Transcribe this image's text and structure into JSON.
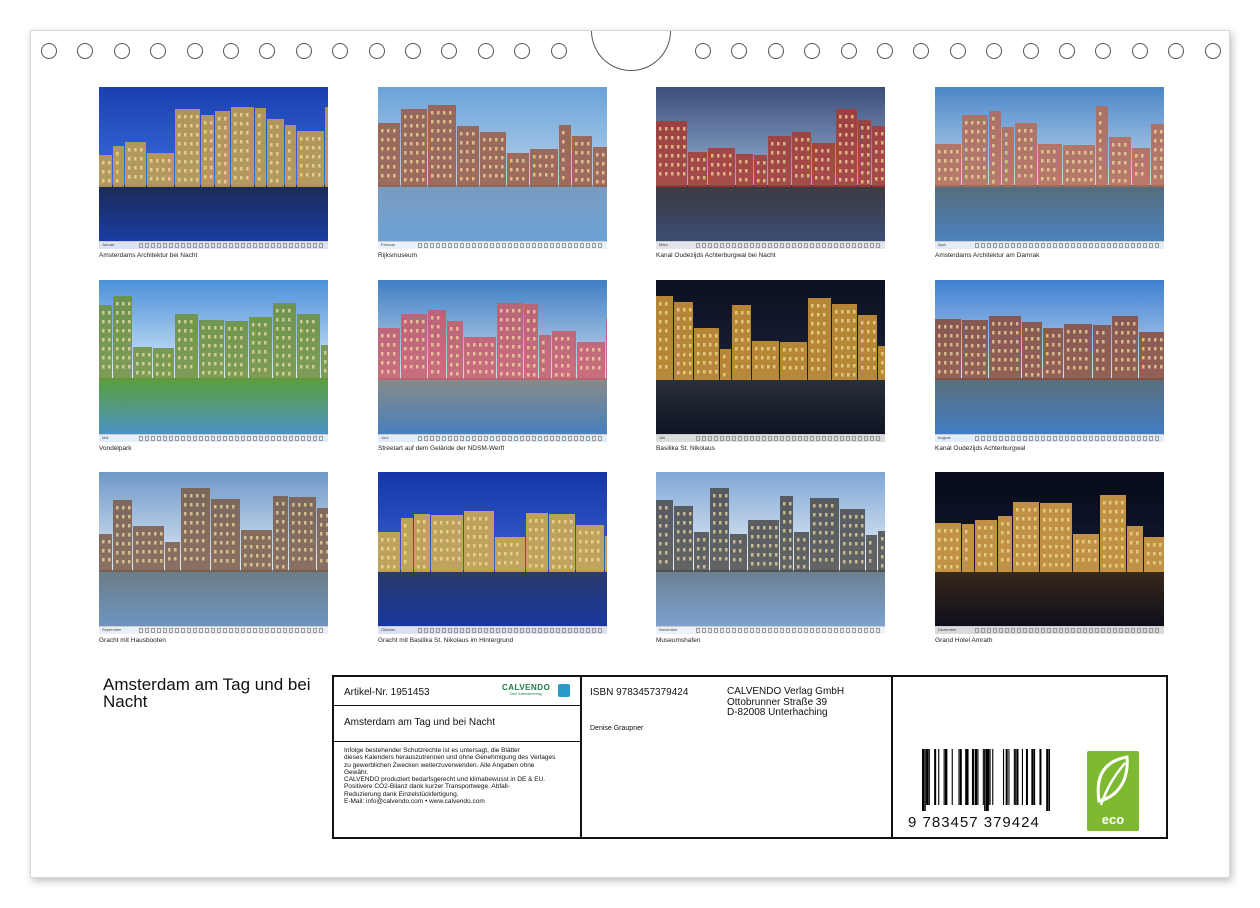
{
  "photos": [
    {
      "caption": "Amsterdams Architektur bei Nacht",
      "month": "Januar"
    },
    {
      "caption": "Rijksmuseum",
      "month": "Februar"
    },
    {
      "caption": "Kanal Oudezijds Achterburgwal bei Nacht",
      "month": "März"
    },
    {
      "caption": "Amsterdams Architektur am Damrak",
      "month": "April"
    },
    {
      "caption": "Vondelpark",
      "month": "Mai"
    },
    {
      "caption": "Streetart auf dem Gelände der NDSM-Werft",
      "month": "Juni"
    },
    {
      "caption": "Basilika St. Nikolaus",
      "month": "Juli"
    },
    {
      "caption": "Kanal Oudezijds Achterburgwal",
      "month": "August"
    },
    {
      "caption": "Gracht mit Hausbooten",
      "month": "September"
    },
    {
      "caption": "Gracht mit Basilika St. Nikolaus im Hintergrund",
      "month": "Oktober"
    },
    {
      "caption": "Museumshafen",
      "month": "November"
    },
    {
      "caption": "Grand Hotel Amrath",
      "month": "Dezember"
    }
  ],
  "calendar_title": "Amsterdam am Tag und bei Nacht",
  "info": {
    "artikel": "Artikel-Nr. 1951453",
    "calvendo_logo": "CALVENDO",
    "calvendo_sub": "Dein Kalenderverlag",
    "title": "Amsterdam am Tag und bei Nacht",
    "legal_lines": [
      "Infolge bestehender Schutzrechte ist es untersagt, die Blätter",
      "dieses Kalenders herauszutrennen und ohne Genehmigung des Verlages",
      "zu gewerblichen Zwecken weiterzuverwenden. Alle Angaben ohne",
      "Gewähr.",
      "CALVENDO produziert bedarfsgerecht und klimabewusst in DE & EU.",
      "Positivere CO2-Bilanz dank kurzer Transportwege. Abfall-",
      "Reduzierung dank Einzelstückfertigung.",
      "E-Mail: info@calvendo.com • www.calvendo.com"
    ],
    "isbn": "ISBN 9783457379424",
    "author": "Denise Graupner",
    "publisher_lines": [
      "CALVENDO Verlag GmbH",
      "Ottobrunner Straße 39",
      "D-82008 Unterhaching"
    ],
    "barcode_number": "9 783457 379424",
    "eco_label": "eco"
  },
  "colors": {
    "calvendo_green": "#1e7a43",
    "eco_green": "#7dba2f",
    "frame": "#111111"
  }
}
